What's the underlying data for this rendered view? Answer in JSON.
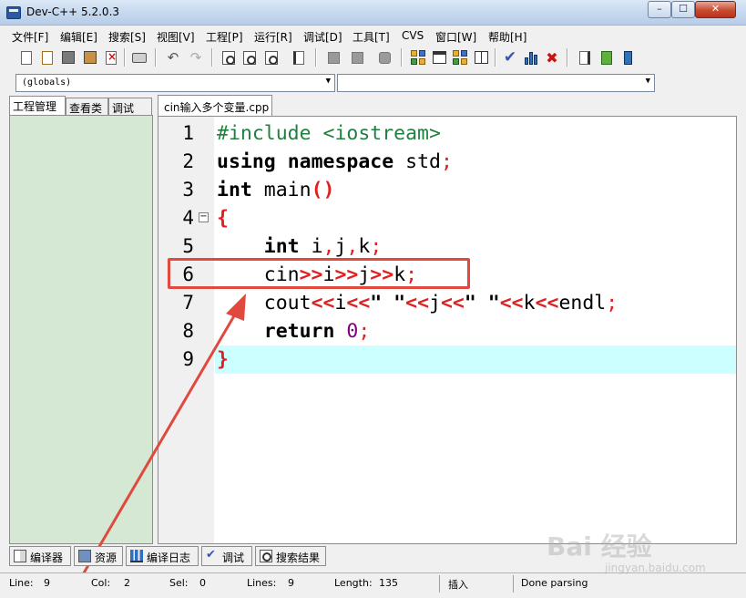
{
  "window": {
    "title": "Dev-C++ 5.2.0.3",
    "min_glyph": "–",
    "max_glyph": "☐",
    "close_glyph": "✕"
  },
  "menu": [
    "文件[F]",
    "编辑[E]",
    "搜索[S]",
    "视图[V]",
    "工程[P]",
    "运行[R]",
    "调试[D]",
    "工具[T]",
    "CVS",
    "窗口[W]",
    "帮助[H]"
  ],
  "toolbar": {
    "icons": [
      "new-file-icon",
      "open-file-icon",
      "save-icon",
      "save-all-icon",
      "close-file-icon",
      "print-icon",
      "undo-icon",
      "redo-icon",
      "find-icon",
      "replace-icon",
      "find-next-icon",
      "goto-line-icon",
      "unindent-icon",
      "indent-icon",
      "toggle-comment-icon",
      "new-project-icon",
      "window-icon",
      "class-browser-icon",
      "grid-icon",
      "check-syntax-icon",
      "chart-icon",
      "delete-icon",
      "insert-icon",
      "add-to-project-icon",
      "info-icon"
    ],
    "undo_glyph": "↶",
    "redo_glyph": "↷",
    "check_glyph": "✔",
    "delete_glyph": "✖"
  },
  "combos": {
    "scope": "(globals)",
    "member": "",
    "arrow": "▼"
  },
  "left_panel": {
    "tabs": [
      "工程管理",
      "查看类",
      "调试"
    ],
    "active_tab": "工程管理"
  },
  "editor": {
    "tab": "cin输入多个变量.cpp",
    "current_line": 9,
    "fold_glyph": "−",
    "lines": [
      {
        "num": "1",
        "text": "#include <iostream>"
      },
      {
        "num": "2",
        "text": "using namespace std;"
      },
      {
        "num": "3",
        "text": "int main()"
      },
      {
        "num": "4",
        "text": "{"
      },
      {
        "num": "5",
        "text": "    int i,j,k;"
      },
      {
        "num": "6",
        "text": "    cin>>i>>j>>k;"
      },
      {
        "num": "7",
        "text": "    cout<<i<<\" \"<<j<<\" \"<<k<<endl;"
      },
      {
        "num": "8",
        "text": "    return 0;"
      },
      {
        "num": "9",
        "text": "}"
      }
    ],
    "annotation": {
      "highlighted_line": 6,
      "color": "#e0493e"
    }
  },
  "bottom_tabs": [
    {
      "label": "编译器",
      "icon": "compiler-icon"
    },
    {
      "label": "资源",
      "icon": "resources-icon"
    },
    {
      "label": "编译日志",
      "icon": "compile-log-icon"
    },
    {
      "label": "调试",
      "icon": "debug-icon"
    },
    {
      "label": "搜索结果",
      "icon": "search-results-icon"
    }
  ],
  "status": {
    "line_label": "Line:",
    "line_value": "9",
    "col_label": "Col:",
    "col_value": "2",
    "sel_label": "Sel:",
    "sel_value": "0",
    "lines_label": "Lines:",
    "lines_value": "9",
    "length_label": "Length:",
    "length_value": "135",
    "mode": "插入",
    "parse_status": "Done parsing"
  },
  "watermark": {
    "text": "Bai 经验",
    "sub": "jingyan.baidu.com"
  },
  "colors": {
    "leftpanel_bg": "#d5e8d4",
    "current_line_bg": "#ccffff",
    "preprocessor": "#208040",
    "symbol": "#e02020",
    "number": "#800080"
  }
}
